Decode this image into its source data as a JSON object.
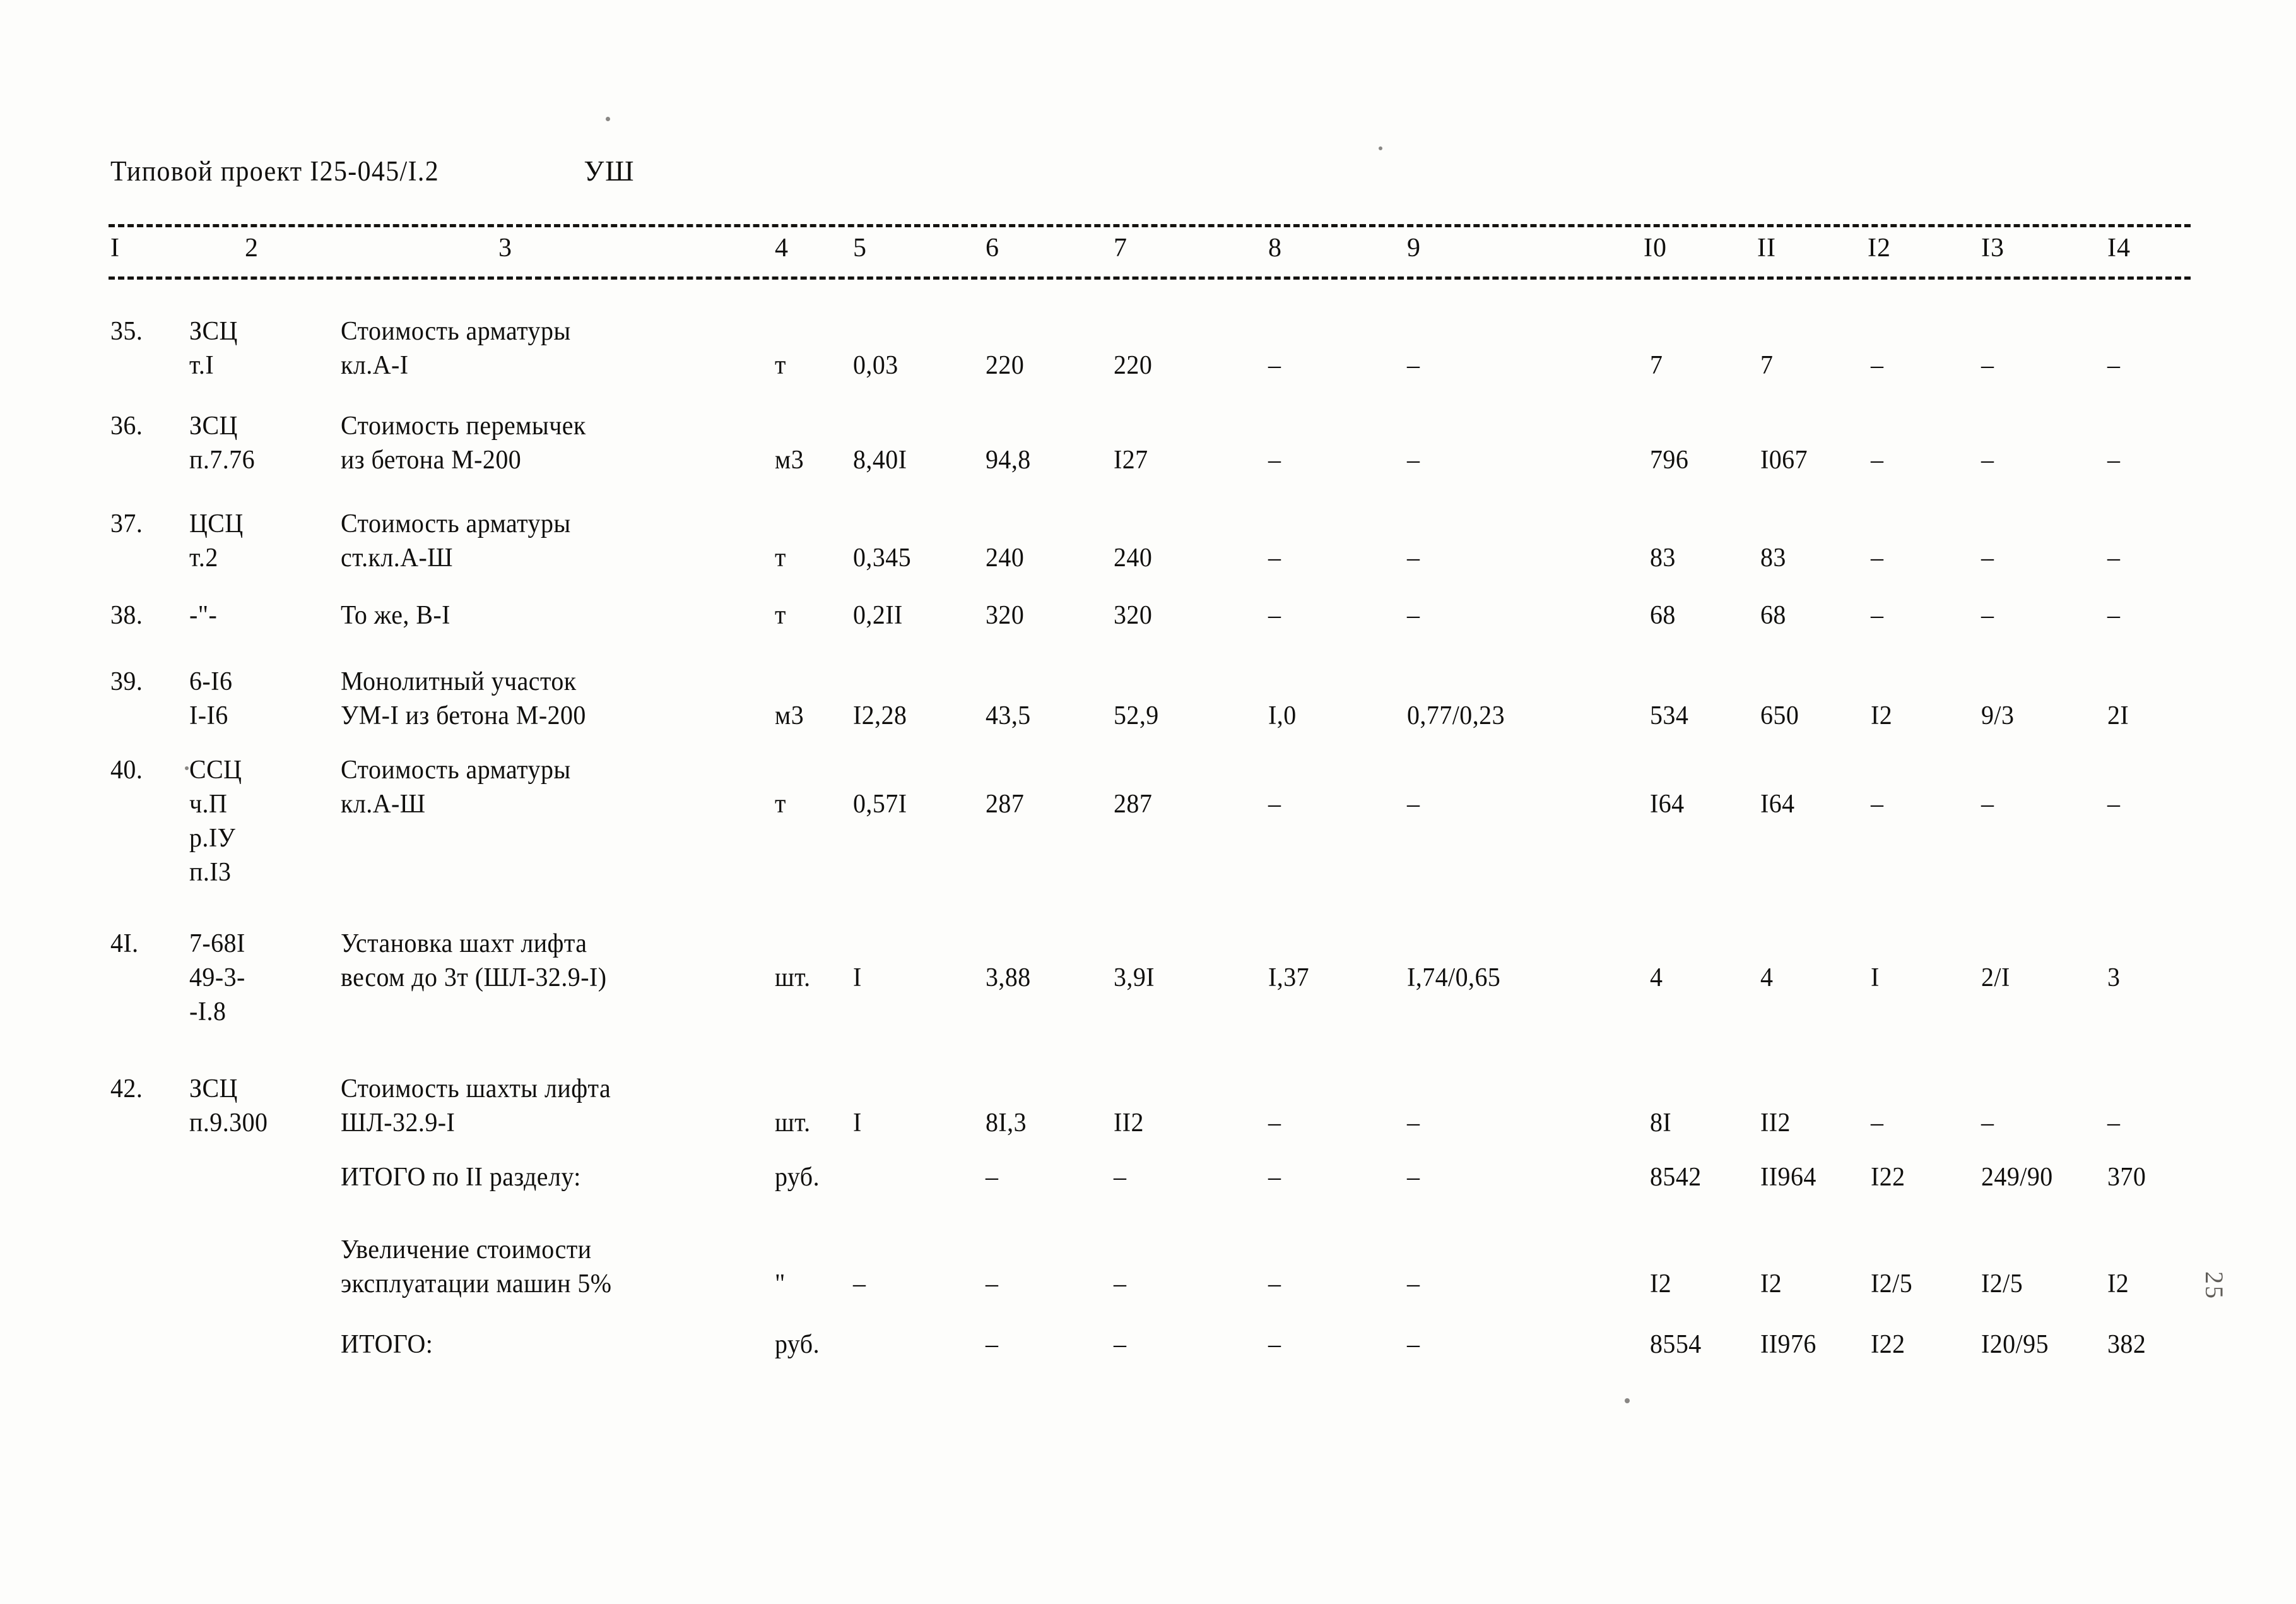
{
  "document": {
    "project_label": "Типовой проект I25-045/I.2",
    "sheet_mark": "УШ"
  },
  "table": {
    "column_numbers": [
      "I",
      "2",
      "3",
      "4",
      "5",
      "6",
      "7",
      "8",
      "9",
      "I0",
      "II",
      "I2",
      "I3",
      "I4"
    ],
    "rows": [
      {
        "no": "35.",
        "code_lines": [
          "ЗСЦ",
          "т.I"
        ],
        "desc_lines": [
          "Стоимость арматуры",
          "кл.А-I"
        ],
        "unit": "т",
        "c5": "0,03",
        "c6": "220",
        "c7": "220",
        "c8": "–",
        "c9": "–",
        "c10": "7",
        "c11": "7",
        "c12": "–",
        "c13": "–",
        "c14": "–"
      },
      {
        "no": "36.",
        "code_lines": [
          "ЗСЦ",
          "п.7.76"
        ],
        "desc_lines": [
          "Стоимость перемычек",
          "из бетона М-200"
        ],
        "unit": "м3",
        "c5": "8,40I",
        "c6": "94,8",
        "c7": "I27",
        "c8": "–",
        "c9": "–",
        "c10": "796",
        "c11": "I067",
        "c12": "–",
        "c13": "–",
        "c14": "–"
      },
      {
        "no": "37.",
        "code_lines": [
          "ЦСЦ",
          "т.2"
        ],
        "desc_lines": [
          "Стоимость арматуры",
          "ст.кл.А-Ш"
        ],
        "unit": "т",
        "c5": "0,345",
        "c6": "240",
        "c7": "240",
        "c8": "–",
        "c9": "–",
        "c10": "83",
        "c11": "83",
        "c12": "–",
        "c13": "–",
        "c14": "–"
      },
      {
        "no": "38.",
        "code_lines": [
          "-\"-"
        ],
        "desc_lines": [
          "То же, В-I"
        ],
        "unit": "т",
        "c5": "0,2II",
        "c6": "320",
        "c7": "320",
        "c8": "–",
        "c9": "–",
        "c10": "68",
        "c11": "68",
        "c12": "–",
        "c13": "–",
        "c14": "–"
      },
      {
        "no": "39.",
        "code_lines": [
          "6-I6",
          "I-I6"
        ],
        "desc_lines": [
          "Монолитный участок",
          "УМ-I из бетона М-200"
        ],
        "unit": "м3",
        "c5": "I2,28",
        "c6": "43,5",
        "c7": "52,9",
        "c8": "I,0",
        "c9": "0,77/0,23",
        "c10": "534",
        "c11": "650",
        "c12": "I2",
        "c13": "9/3",
        "c14": "2I"
      },
      {
        "no": "40.",
        "code_lines": [
          "ССЦ",
          "ч.П",
          "р.IУ",
          "п.I3"
        ],
        "desc_lines": [
          "Стоимость арматуры",
          "кл.А-Ш"
        ],
        "unit": "т",
        "c5": "0,57I",
        "c6": "287",
        "c7": "287",
        "c8": "–",
        "c9": "–",
        "c10": "I64",
        "c11": "I64",
        "c12": "–",
        "c13": "–",
        "c14": "–"
      },
      {
        "no": "4I.",
        "code_lines": [
          "7-68I",
          "49-3-",
          "-I.8"
        ],
        "desc_lines": [
          "Установка шахт лифта",
          "весом до 3т (ШЛ-32.9-I)"
        ],
        "unit": "шт.",
        "c5": "I",
        "c6": "3,88",
        "c7": "3,9I",
        "c8": "I,37",
        "c9": "I,74/0,65",
        "c10": "4",
        "c11": "4",
        "c12": "I",
        "c13": "2/I",
        "c14": "3"
      },
      {
        "no": "42.",
        "code_lines": [
          "ЗСЦ",
          "п.9.300"
        ],
        "desc_lines": [
          "Стоимость шахты лифта",
          "ШЛ-32.9-I"
        ],
        "unit": "шт.",
        "c5": "I",
        "c6": "8I,3",
        "c7": "II2",
        "c8": "–",
        "c9": "–",
        "c10": "8I",
        "c11": "II2",
        "c12": "–",
        "c13": "–",
        "c14": "–"
      }
    ],
    "summary_rows": [
      {
        "no": "",
        "code_lines": [],
        "desc_lines": [
          "ИТОГО по II разделу:"
        ],
        "unit": "руб.",
        "c5": "",
        "c6": "–",
        "c7": "–",
        "c8": "–",
        "c9": "–",
        "c10": "8542",
        "c11": "II964",
        "c12": "I22",
        "c13": "249/90",
        "c14": "370"
      },
      {
        "no": "",
        "code_lines": [],
        "desc_lines": [
          "Увеличение стоимости",
          "эксплуатации машин 5%"
        ],
        "unit": "\"",
        "c5": "–",
        "c6": "–",
        "c7": "–",
        "c8": "–",
        "c9": "–",
        "c10": "I2",
        "c11": "I2",
        "c12": "I2/5",
        "c13": "I2/5",
        "c14": "I2"
      },
      {
        "no": "",
        "code_lines": [],
        "desc_lines": [
          "ИТОГО:"
        ],
        "unit": "руб.",
        "c5": "",
        "c6": "–",
        "c7": "–",
        "c8": "–",
        "c9": "–",
        "c10": "8554",
        "c11": "II976",
        "c12": "I22",
        "c13": "I20/95",
        "c14": "382"
      }
    ]
  },
  "margin_mark": "25"
}
